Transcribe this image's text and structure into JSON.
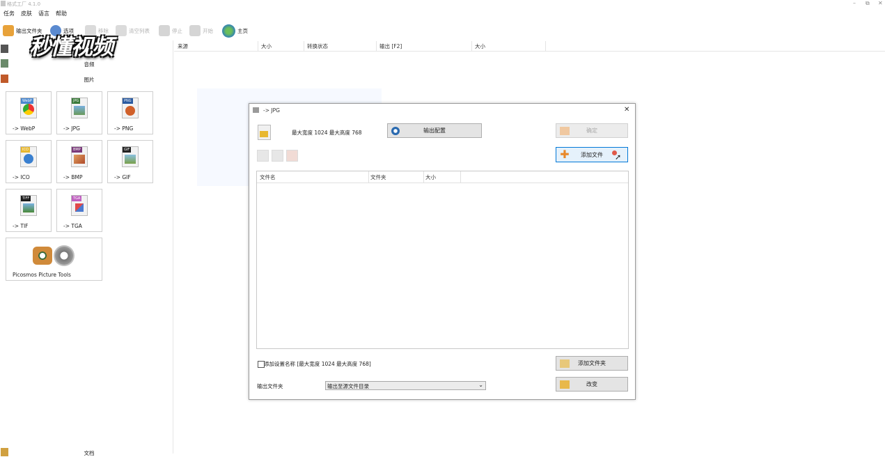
{
  "app": {
    "title": "格式工厂 4.1.0"
  },
  "menu": [
    "任务",
    "皮肤",
    "语言",
    "帮助"
  ],
  "toolbar": {
    "output_folder": "输出文件夹",
    "options": "选项",
    "remove": "移除",
    "clear": "清空列表",
    "stop": "停止",
    "start": "开始",
    "home": "主页"
  },
  "watermark": "秒懂视频",
  "sidebar": {
    "audio_label": "音频",
    "image_label": "图片",
    "doc_label": "文档",
    "tiles": [
      {
        "label": "-> WebP",
        "icon": "webp-icon",
        "tag": "WebP",
        "color": "#4a88d0"
      },
      {
        "label": "-> JPG",
        "icon": "jpg-icon",
        "tag": "JPG",
        "color": "#3a7a3a"
      },
      {
        "label": "-> PNG",
        "icon": "png-icon",
        "tag": "PNG",
        "color": "#2a5aa0"
      },
      {
        "label": "-> ICO",
        "icon": "ico-icon",
        "tag": "ICO",
        "color": "#e8b830"
      },
      {
        "label": "-> BMP",
        "icon": "bmp-icon",
        "tag": "BMP",
        "color": "#7a3a7a"
      },
      {
        "label": "-> GIF",
        "icon": "gif-icon",
        "tag": "GIF",
        "color": "#222222"
      },
      {
        "label": "-> TIF",
        "icon": "tif-icon",
        "tag": "TIFF",
        "color": "#1a1a1a"
      },
      {
        "label": "-> TGA",
        "icon": "tga-icon",
        "tag": "TGA",
        "color": "#c060c0"
      },
      {
        "label": "Picosmos Picture Tools",
        "icon": "picosmos-icon",
        "tag": "",
        "color": "#888888"
      }
    ]
  },
  "list": {
    "columns": [
      "来源",
      "大小",
      "转换状态",
      "输出 [F2]",
      "大小"
    ]
  },
  "dialog": {
    "title": "-> JPG",
    "info": "最大宽度 1024 最大高度 768",
    "output_config": "输出配置",
    "ok": "确定",
    "add_file": "添加文件",
    "table_columns": [
      "文件名",
      "文件夹",
      "大小"
    ],
    "add_setting_name": "添加设置名称 [最大宽度 1024 最大高度 768]",
    "add_folder": "添加文件夹",
    "output_folder_label": "输出文件夹",
    "output_folder_value": "输出至源文件目录",
    "change": "改变"
  },
  "colors": {
    "accent": "#0078d7",
    "button_bg": "#e4e4e4"
  }
}
